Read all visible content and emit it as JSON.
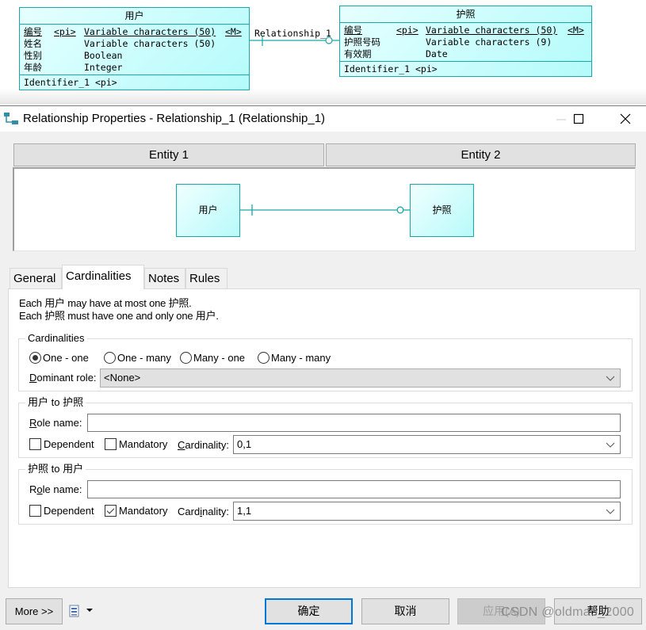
{
  "diagram": {
    "entity_user": {
      "title": "用户",
      "attributes": [
        {
          "name": "编号",
          "key": "<pi>",
          "type": "Variable characters (50)",
          "flag": "<M>"
        },
        {
          "name": "姓名",
          "key": "",
          "type": "Variable characters (50)",
          "flag": ""
        },
        {
          "name": "性别",
          "key": "",
          "type": "Boolean",
          "flag": ""
        },
        {
          "name": "年龄",
          "key": "",
          "type": "Integer",
          "flag": ""
        }
      ],
      "identifier": "Identifier_1  <pi>"
    },
    "entity_passport": {
      "title": "护照",
      "attributes": [
        {
          "name": "编号",
          "key": "<pi>",
          "type": "Variable characters (50)",
          "flag": "<M>"
        },
        {
          "name": "护照号码",
          "key": "",
          "type": "Variable characters (9)",
          "flag": ""
        },
        {
          "name": "有效期",
          "key": "",
          "type": "Date",
          "flag": ""
        }
      ],
      "identifier": "Identifier_1  <pi>"
    },
    "relationship_label": "Relationship_1",
    "colors": {
      "entity_border": "#1aa7a7",
      "entity_fill": "#b4fbfb"
    }
  },
  "dialog": {
    "title": "Relationship Properties - Relationship_1 (Relationship_1)",
    "window_controls": {
      "minimize": "minimize",
      "maximize": "maximize",
      "close": "close"
    },
    "entity_headers": {
      "entity1": "Entity 1",
      "entity2": "Entity 2"
    },
    "preview": {
      "entity1": "用户",
      "entity2": "护照"
    },
    "tabs": [
      {
        "label": "General",
        "active": false
      },
      {
        "label": "Cardinalities",
        "active": true
      },
      {
        "label": "Notes",
        "active": false
      },
      {
        "label": "Rules",
        "active": false
      }
    ],
    "summary": {
      "line1": "Each 用户 may have at most one 护照.",
      "line2": "Each 护照 must have one and only one 用户."
    },
    "cardinalities_group": {
      "legend": "Cardinalities",
      "options": [
        {
          "label": "One - one",
          "checked": true
        },
        {
          "label": "One - many",
          "checked": false
        },
        {
          "label": "Many - one",
          "checked": false
        },
        {
          "label": "Many - many",
          "checked": false
        }
      ],
      "dominant_role_label_first": "D",
      "dominant_role_label_rest": "ominant role:",
      "dominant_role_value": "<None>"
    },
    "role_user_to_passport": {
      "legend": "用户 to 护照",
      "role_name_label_pre": "",
      "role_name_label_ul": "R",
      "role_name_label_post": "ole name:",
      "role_name_value": "",
      "dependent_pre": "D",
      "dependent_ul": "e",
      "dependent_post": "pendent",
      "dependent_checked": false,
      "mandatory_pre": "",
      "mandatory_ul": "M",
      "mandatory_post": "andatory",
      "mandatory_checked": false,
      "cardinality_pre": "",
      "cardinality_ul": "C",
      "cardinality_post": "ardinality:",
      "cardinality_value": "0,1"
    },
    "role_passport_to_user": {
      "legend": "护照 to 用户",
      "role_name_label_pre": "R",
      "role_name_label_ul": "o",
      "role_name_label_post": "le name:",
      "role_name_value": "",
      "dependent_pre": "De",
      "dependent_ul": "p",
      "dependent_post": "endent",
      "dependent_checked": false,
      "mandatory_pre": "M",
      "mandatory_ul": "a",
      "mandatory_post": "ndatory",
      "mandatory_checked": true,
      "cardinality_pre": "Card",
      "cardinality_ul": "i",
      "cardinality_post": "nality:",
      "cardinality_value": "1,1"
    },
    "buttons": {
      "more": "More >>",
      "ok": "确定",
      "cancel": "取消",
      "apply": "应用(A)",
      "help": "帮助"
    },
    "watermark": "CSDN @oldmao_2000"
  }
}
